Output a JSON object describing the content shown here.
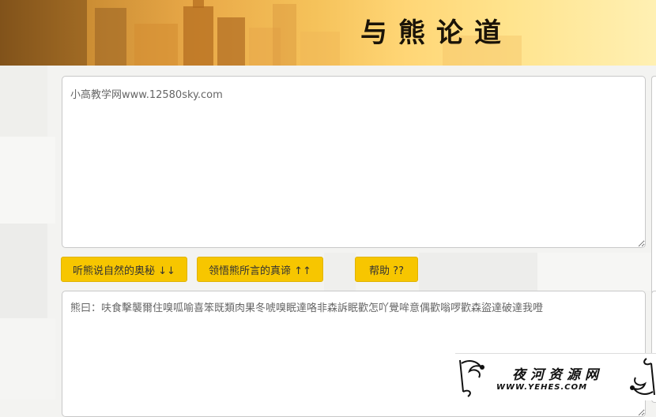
{
  "header": {
    "title": "与熊论道"
  },
  "input": {
    "value": "小高教学网www.12580sky.com"
  },
  "buttons": {
    "decode_label": "听熊说自然的奥秘 ↓↓",
    "encode_label": "领悟熊所言的真谛 ↑↑",
    "help_label": "帮助 ??"
  },
  "output": {
    "value": "熊曰：呋食擊襲爾住嗅呱喻喜笨既類肉果冬唬嗅眠達咯非森訴眠歡怎吖覺哞意偶歡嗡啰歡森盜達破達我噔"
  },
  "watermark": {
    "name": "夜河资源网",
    "url": "WWW.YEHES.COM"
  },
  "colors": {
    "button": "#f7c600",
    "banner_light": "#ffe48e",
    "banner_dark": "#8a5a1e"
  }
}
